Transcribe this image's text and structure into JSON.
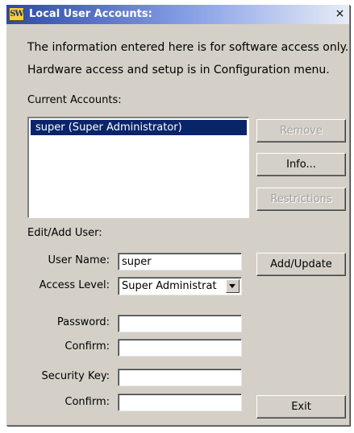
{
  "window": {
    "title": "Local User Accounts:",
    "app_icon_text": "SW",
    "close_glyph": "×",
    "icons": {
      "app": "app-logo-icon",
      "close": "close-icon",
      "dropdown": "chevron-down-icon"
    }
  },
  "info": {
    "line1": "The information entered here is for software access only.",
    "line2": "Hardware access and setup is in Configuration menu."
  },
  "accounts": {
    "label": "Current Accounts:",
    "items": [
      {
        "text": "super (Super Administrator)",
        "selected": true
      }
    ]
  },
  "buttons": {
    "remove": "Remove",
    "info": "Info...",
    "restrictions": "Restrictions",
    "add_update": "Add/Update",
    "exit": "Exit"
  },
  "edit": {
    "label": "Edit/Add User:",
    "username_label": "User Name:",
    "username_value": "super",
    "access_label": "Access Level:",
    "access_value": "Super Administrat",
    "password_label": "Password:",
    "password_value": "",
    "confirm_label": "Confirm:",
    "confirm_value": "",
    "security_key_label": "Security Key:",
    "security_key_value": "",
    "confirm2_label": "Confirm:",
    "confirm2_value": ""
  },
  "colors": {
    "title_bar_start": "#2c49a8",
    "selection": "#0a246a",
    "dialog_bg": "#d4d0c8",
    "disabled_text": "#a0a0a0"
  }
}
